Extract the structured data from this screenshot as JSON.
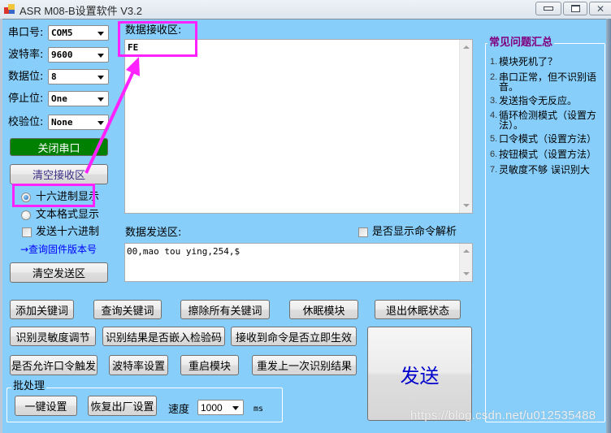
{
  "window": {
    "title": "ASR M08-B设置软件 V3.2",
    "controls": {
      "minimize": "minimize",
      "maximize": "maximize",
      "close": "close"
    }
  },
  "colors": {
    "background": "#87CEFA",
    "close_port_button": "#008000",
    "annotation": "#FF22FF",
    "faq_title": "#800080",
    "send_button_text": "#0000CD",
    "link": "#0000FF",
    "clear_receive_text": "#3B2F86"
  },
  "serial": {
    "fields": [
      {
        "label": "串口号:",
        "value": "COM5"
      },
      {
        "label": "波特率:",
        "value": "9600"
      },
      {
        "label": "数据位:",
        "value": "8"
      },
      {
        "label": "停止位:",
        "value": "One"
      },
      {
        "label": "校验位:",
        "value": "None"
      }
    ],
    "close_port": "关闭串口",
    "clear_receive": "清空接收区",
    "display_modes": [
      {
        "label": "十六进制显示",
        "selected": true
      },
      {
        "label": "文本格式显示",
        "selected": false
      }
    ],
    "send_hex": {
      "label": "发送十六进制",
      "checked": false
    },
    "query_firmware": "→查询固件版本号",
    "clear_send": "清空发送区"
  },
  "receive": {
    "label": "数据接收区:",
    "content": "FE"
  },
  "send": {
    "label": "数据发送区:",
    "content": "00,mao tou ying,254,$",
    "show_parse": {
      "label": "是否显示命令解析",
      "checked": false
    }
  },
  "faq": {
    "title": "常见问题汇总",
    "items": [
      {
        "num": "1.",
        "text": "模块死机了？"
      },
      {
        "num": "2.",
        "text": "串口正常，但不识别语音。"
      },
      {
        "num": "3.",
        "text": "发送指令无反应。"
      },
      {
        "num": "4.",
        "text": "循环检测模式（设置方法）。"
      },
      {
        "num": "5.",
        "text": "口令模式（设置方法）"
      },
      {
        "num": "6.",
        "text": "按钮模式（设置方法）"
      },
      {
        "num": "7.",
        "text": "灵敏度不够 误识别大"
      }
    ]
  },
  "commands": {
    "row1": [
      "添加关键词",
      "查询关键词",
      "擦除所有关键词",
      "休眠模块",
      "退出休眠状态"
    ],
    "row2": [
      "识别灵敏度调节",
      "识别结果是否嵌入检验码",
      "接收到命令是否立即生效"
    ],
    "row3": [
      "是否允许口令触发",
      "波特率设置",
      "重启模块",
      "重发上一次识别结果"
    ]
  },
  "send_button": "发送",
  "batch": {
    "title": "批处理",
    "one_click": "一键设置",
    "factory_reset": "恢复出厂设置",
    "speed_label": "速度",
    "speed_value": "1000",
    "speed_unit": "ms"
  },
  "watermark": "https://blog.csdn.net/u012535488"
}
